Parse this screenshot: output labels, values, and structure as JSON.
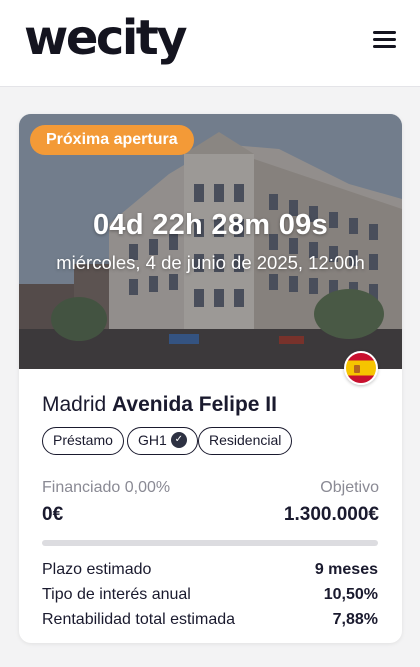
{
  "header": {
    "logo_text": "wecity",
    "menu_icon": "hamburger-menu-icon"
  },
  "card": {
    "badge": "Próxima apertura",
    "countdown": "04d 22h 28m 09s",
    "opening_date": "miércoles, 4 de junio de 2025, 12:00h",
    "flag_icon": "spain-flag-icon",
    "city": "Madrid",
    "street": "Avenida Felipe II",
    "tags": [
      "Préstamo",
      "GH1",
      "Residencial"
    ],
    "tag_verified_icon": "check-circle-icon",
    "financed_label": "Financiado 0,00%",
    "financed_fraction": 0.0,
    "objective_label": "Objetivo",
    "financed_value": "0€",
    "objective_value": "1.300.000€",
    "details": [
      {
        "label": "Plazo estimado",
        "value": "9 meses"
      },
      {
        "label": "Tipo de interés anual",
        "value": "10,50%"
      },
      {
        "label": "Rentabilidad total estimada",
        "value": "7,88%"
      }
    ]
  },
  "colors": {
    "accent": "#f39a37",
    "text": "#1a1a2e",
    "muted": "#8a8a94",
    "progress_track": "#dcdce0",
    "page_background": "#f3f3f4"
  }
}
